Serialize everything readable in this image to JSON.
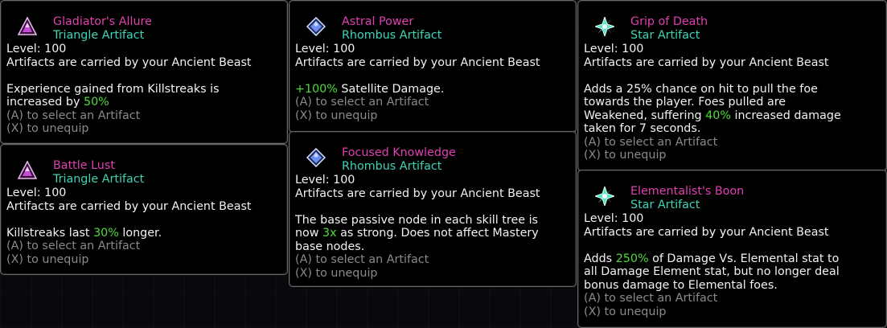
{
  "common": {
    "level": "Level: 100",
    "carried": "Artifacts are carried by your Ancient Beast",
    "select_hint": "(A) to select an Artifact",
    "unequip_hint": "(X) to unequip"
  },
  "colors": {
    "name": "#e040b0",
    "type": "#3fd4b6",
    "highlight": "#52d93e",
    "hint": "#8a8a8a",
    "border": "#6a6a6a"
  },
  "tooltips": [
    {
      "name": "Gladiator's Allure",
      "type": "Triangle Artifact",
      "icon": "triangle-artifact-icon",
      "description": [
        [
          "Experience gained from Killstreaks is"
        ],
        [
          "increased by ",
          {
            "hl": "50%"
          }
        ]
      ]
    },
    {
      "name": "Battle Lust",
      "type": "Triangle Artifact",
      "icon": "triangle-artifact-icon",
      "description": [
        [
          "Killstreaks last ",
          {
            "hl": "30%"
          },
          " longer."
        ]
      ]
    },
    {
      "name": "Astral Power",
      "type": "Rhombus Artifact",
      "icon": "rhombus-artifact-icon",
      "description": [
        [
          {
            "hl": "+100%"
          },
          " Satellite Damage."
        ]
      ]
    },
    {
      "name": "Focused Knowledge",
      "type": "Rhombus Artifact",
      "icon": "rhombus-artifact-icon",
      "description": [
        [
          "The base passive node in each skill tree is"
        ],
        [
          "now ",
          {
            "hl": "3x"
          },
          " as strong. Does not affect Mastery"
        ],
        [
          "base nodes."
        ]
      ]
    },
    {
      "name": "Grip of Death",
      "type": "Star Artifact",
      "icon": "star-artifact-icon",
      "description": [
        [
          "Adds a 25% chance on hit to pull the foe"
        ],
        [
          "towards the player. Foes pulled are"
        ],
        [
          "Weakened, suffering ",
          {
            "hl": "40%"
          },
          " increased damage"
        ],
        [
          "taken for 7 seconds."
        ]
      ]
    },
    {
      "name": "Elementalist's Boon",
      "type": "Star Artifact",
      "icon": "star-artifact-icon",
      "description": [
        [
          "Adds ",
          {
            "hl": "250%"
          },
          " of Damage Vs. Elemental stat to"
        ],
        [
          "all Damage Element stat, but no longer deal"
        ],
        [
          "bonus damage to Elemental foes."
        ]
      ]
    }
  ]
}
